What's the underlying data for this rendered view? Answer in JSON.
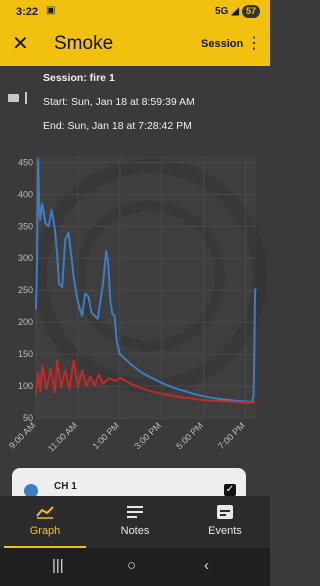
{
  "status_bar": {
    "time": "3:22",
    "network": "5G",
    "battery": "57"
  },
  "app_bar": {
    "title": "Smoke",
    "session_label": "Session"
  },
  "session_info": {
    "session": "Session: fire 1",
    "start": "Start: Sun, Jan 18 at 8:59:39 AM",
    "end": "End: Sun, Jan 18 at 7:28:42 PM"
  },
  "colors": {
    "accent": "#f2c10f",
    "series_blue": "#3d7dc3",
    "series_red": "#c62828"
  },
  "chart_data": {
    "type": "line",
    "ylim": [
      50,
      460
    ],
    "yticks": [
      "450",
      "400",
      "350",
      "300",
      "250",
      "200",
      "150",
      "100",
      "50"
    ],
    "xticks": [
      "9:00 AM",
      "11:00 AM",
      "1:00 PM",
      "3:00 PM",
      "5:00 PM",
      "7:00 PM"
    ],
    "grid": true,
    "series": [
      {
        "name": "CH 1",
        "color": "#3d7dc3",
        "x": [
          9.0,
          9.05,
          9.1,
          9.15,
          9.2,
          9.3,
          9.45,
          9.6,
          9.75,
          9.9,
          10.0,
          10.1,
          10.25,
          10.4,
          10.55,
          10.7,
          10.8,
          10.95,
          11.05,
          11.2,
          11.35,
          11.5,
          11.65,
          11.8,
          11.95,
          12.05,
          12.2,
          12.35,
          12.45,
          12.55,
          12.65,
          12.75,
          12.85,
          13.0,
          13.5,
          14.0,
          14.5,
          15.0,
          15.5,
          16.0,
          16.5,
          17.0,
          17.5,
          18.0,
          18.5,
          19.0,
          19.25,
          19.33,
          19.38,
          19.42,
          19.45,
          19.48
        ],
        "values": [
          220,
          290,
          455,
          390,
          360,
          385,
          355,
          350,
          375,
          345,
          310,
          260,
          255,
          330,
          340,
          300,
          270,
          240,
          225,
          210,
          245,
          240,
          215,
          210,
          205,
          228,
          260,
          312,
          290,
          232,
          212,
          210,
          170,
          150,
          135,
          122,
          113,
          105,
          98,
          93,
          88,
          84,
          81,
          79,
          77,
          76,
          75,
          75,
          85,
          150,
          245,
          253
        ]
      },
      {
        "name": "",
        "color": "#c62828",
        "x": [
          9.0,
          9.1,
          9.2,
          9.3,
          9.5,
          9.7,
          9.9,
          10.0,
          10.2,
          10.4,
          10.6,
          10.8,
          11.0,
          11.2,
          11.4,
          11.6,
          11.8,
          12.0,
          12.2,
          12.5,
          12.8,
          13.0,
          13.5,
          14.0,
          14.5,
          15.0,
          15.5,
          16.0,
          16.5,
          17.0,
          17.5,
          18.0,
          18.5,
          19.0,
          19.3,
          19.45
        ],
        "values": [
          88,
          120,
          92,
          132,
          95,
          128,
          90,
          140,
          98,
          125,
          95,
          140,
          98,
          125,
          100,
          115,
          100,
          118,
          104,
          112,
          108,
          113,
          104,
          97,
          92,
          88,
          85,
          82,
          80,
          78,
          77,
          76,
          75,
          74,
          74,
          75
        ]
      }
    ]
  },
  "legend": {
    "ch1_label": "CH 1",
    "ch1_checked": "✓"
  },
  "bottom_nav": {
    "graph": "Graph",
    "notes": "Notes",
    "events": "Events"
  },
  "icons": [
    "close-icon",
    "more-vert-icon",
    "graph-icon",
    "notes-icon",
    "events-icon",
    "card-icon",
    "recents-icon",
    "home-icon",
    "back-icon"
  ]
}
